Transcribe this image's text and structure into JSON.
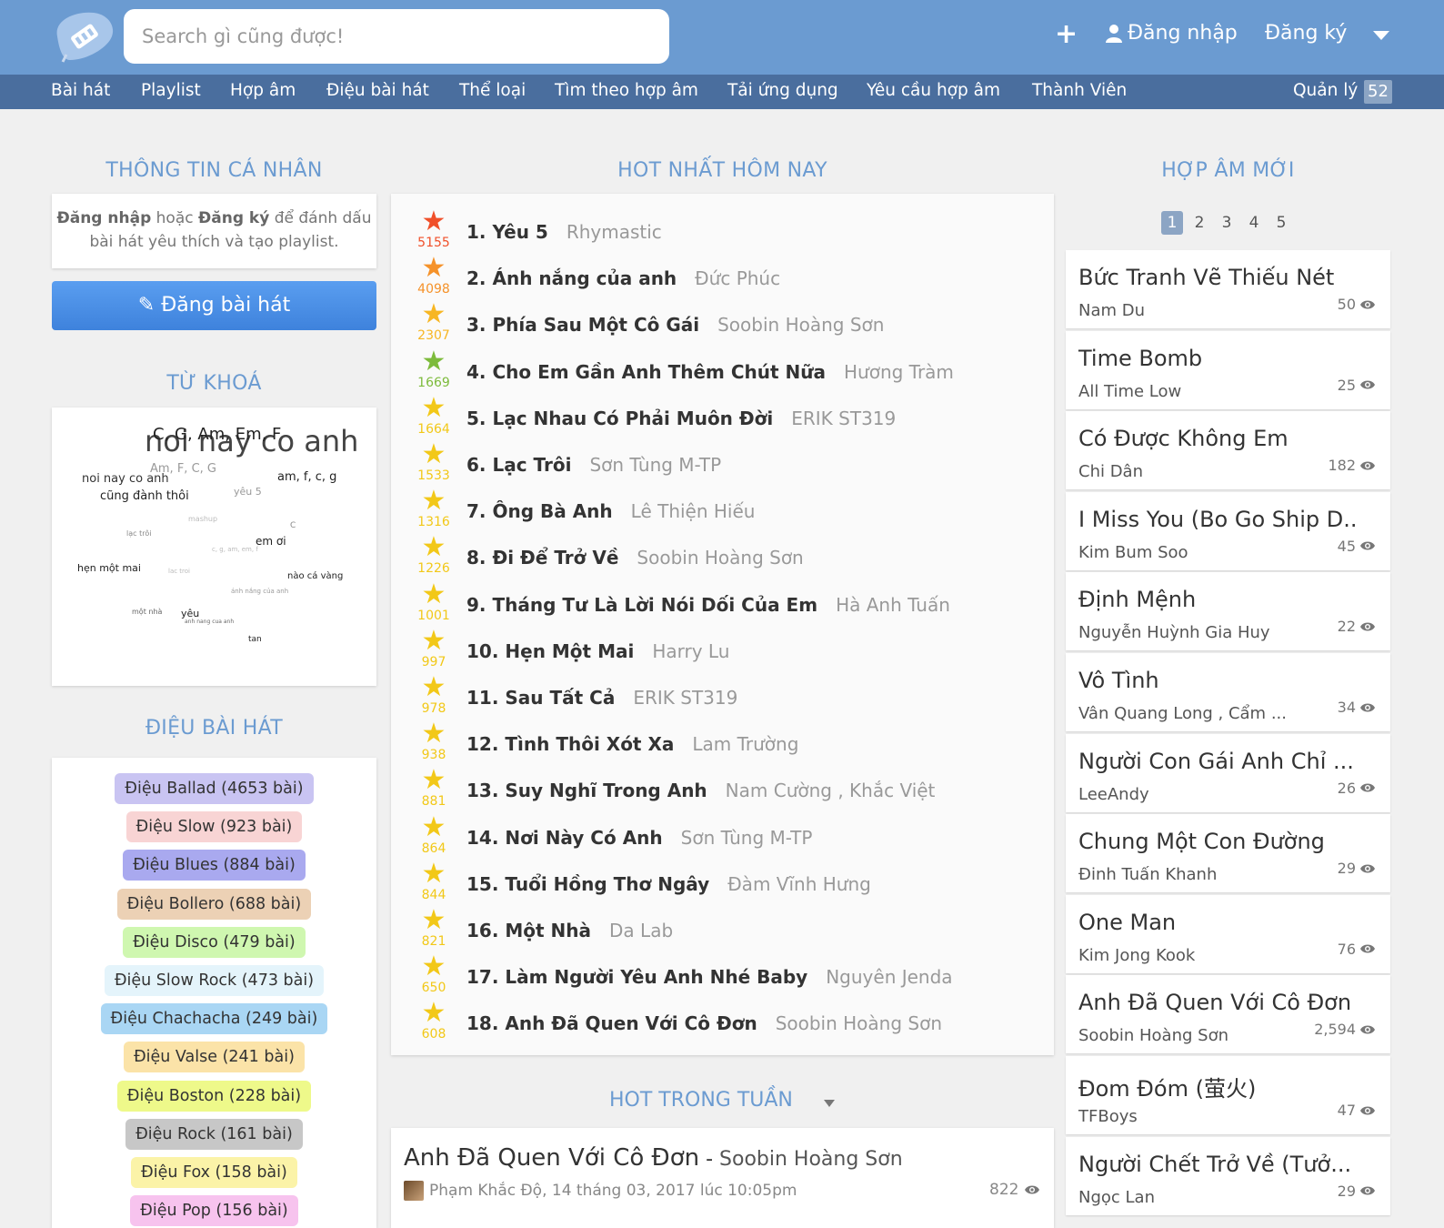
{
  "header": {
    "search_placeholder": "Search gì cũng được!",
    "plus_label": "+",
    "login_label": "Đăng nhập",
    "register_label": "Đăng ký"
  },
  "nav": {
    "items": [
      "Bài hát",
      "Playlist",
      "Hợp âm",
      "Điệu bài hát",
      "Thể loại",
      "Tìm theo hợp âm",
      "Tải ứng dụng",
      "Yêu cầu hợp âm",
      "Thành Viên"
    ],
    "manage_label": "Quản lý",
    "manage_count": "52"
  },
  "left": {
    "profile_title": "THÔNG TIN CÁ NHÂN",
    "login_note_1": "Đăng nhập",
    "login_note_2": " hoặc ",
    "login_note_3": "Đăng ký",
    "login_note_4": " để đánh dấu bài hát yêu thích và tạo playlist.",
    "post_button": "Đăng bài hát",
    "keywords_title": "TỪ KHOÁ",
    "cloud": [
      {
        "text": "C, G, Am, Em, F"
      },
      {
        "text": "noi nay co anh"
      },
      {
        "text": "Am, F, C, G"
      },
      {
        "text": "noi nay co anh"
      },
      {
        "text": "am, f, c, g"
      },
      {
        "text": "cũng đành thôi"
      },
      {
        "text": "yêu 5"
      },
      {
        "text": "mashup"
      },
      {
        "text": "C"
      },
      {
        "text": "lạc trôi"
      },
      {
        "text": "em ơi"
      },
      {
        "text": "c, g, am, em, f"
      },
      {
        "text": "hẹn một mai"
      },
      {
        "text": "lac troi"
      },
      {
        "text": "nào cá vàng"
      },
      {
        "text": "ánh nắng của anh"
      },
      {
        "text": "một nhà"
      },
      {
        "text": "yêu"
      },
      {
        "text": "anh nang cua anh"
      },
      {
        "text": "tan"
      }
    ],
    "genre_title": "ĐIỆU BÀI HÁT",
    "genres": [
      {
        "label": "Điệu Ballad (4653 bài)",
        "color": "#c9c4f2"
      },
      {
        "label": "Điệu Slow (923 bài)",
        "color": "#f8d4d4"
      },
      {
        "label": "Điệu Blues (884 bài)",
        "color": "#a9a9ef"
      },
      {
        "label": "Điệu Bollero (688 bài)",
        "color": "#ecd1b5"
      },
      {
        "label": "Điệu Disco (479 bài)",
        "color": "#cff7b0"
      },
      {
        "label": "Điệu Slow Rock (473 bài)",
        "color": "#e4f4fb"
      },
      {
        "label": "Điệu Chachacha (249 bài)",
        "color": "#a9d6f4"
      },
      {
        "label": "Điệu Valse (241 bài)",
        "color": "#fbe3a8"
      },
      {
        "label": "Điệu Boston (228 bài)",
        "color": "#eef98a"
      },
      {
        "label": "Điệu Rock (161 bài)",
        "color": "#c7c7c7"
      },
      {
        "label": "Điệu Fox (158 bài)",
        "color": "#fbf3a8"
      },
      {
        "label": "Điệu Pop (156 bài)",
        "color": "#f7c3ee"
      }
    ]
  },
  "hot": {
    "title": "HOT NHẤT HÔM NAY",
    "items": [
      {
        "rank_title": "1. Yêu 5",
        "artist": "Rhymastic",
        "count": "5155",
        "color": "#f0502a"
      },
      {
        "rank_title": "2. Ánh nắng của anh",
        "artist": "Đức Phúc",
        "count": "4098",
        "color": "#f5922a"
      },
      {
        "rank_title": "3. Phía Sau Một Cô Gái",
        "artist": "Soobin Hoàng Sơn",
        "count": "2307",
        "color": "#f7b623"
      },
      {
        "rank_title": "4. Cho Em Gần Anh Thêm Chút Nữa",
        "artist": "Hương Tràm",
        "count": "1669",
        "color": "#7dbb3c"
      },
      {
        "rank_title": "5. Lạc Nhau Có Phải Muôn Đời",
        "artist": "ERIK ST319",
        "count": "1664",
        "color": "#f2c818"
      },
      {
        "rank_title": "6. Lạc Trôi",
        "artist": "Sơn Tùng M-TP",
        "count": "1533",
        "color": "#f2c818"
      },
      {
        "rank_title": "7. Ông Bà Anh",
        "artist": "Lê Thiện Hiếu",
        "count": "1316",
        "color": "#f2c818"
      },
      {
        "rank_title": "8. Đi Để Trở Về",
        "artist": "Soobin Hoàng Sơn",
        "count": "1226",
        "color": "#f2c818"
      },
      {
        "rank_title": "9. Tháng Tư Là Lời Nói Dối Của Em",
        "artist": "Hà Anh Tuấn",
        "count": "1001",
        "color": "#f2c818"
      },
      {
        "rank_title": "10. Hẹn Một Mai",
        "artist": "Harry Lu",
        "count": "997",
        "color": "#f2c818"
      },
      {
        "rank_title": "11. Sau Tất Cả",
        "artist": "ERIK ST319",
        "count": "978",
        "color": "#f2c818"
      },
      {
        "rank_title": "12. Tình Thôi Xót Xa",
        "artist": "Lam Trường",
        "count": "938",
        "color": "#f2c818"
      },
      {
        "rank_title": "13. Suy Nghĩ Trong Anh",
        "artist": "Nam Cường , Khắc Việt",
        "count": "881",
        "color": "#f2c818"
      },
      {
        "rank_title": "14. Nơi Này Có Anh",
        "artist": "Sơn Tùng M-TP",
        "count": "864",
        "color": "#f2c818"
      },
      {
        "rank_title": "15. Tuổi Hồng Thơ Ngây",
        "artist": "Đàm Vĩnh Hưng",
        "count": "844",
        "color": "#f2c818"
      },
      {
        "rank_title": "16. Một Nhà",
        "artist": "Da Lab",
        "count": "821",
        "color": "#f2c818"
      },
      {
        "rank_title": "17. Làm Người Yêu Anh Nhé Baby",
        "artist": "Nguyên Jenda",
        "count": "650",
        "color": "#f2c818"
      },
      {
        "rank_title": "18. Anh Đã Quen Với Cô Đơn",
        "artist": "Soobin Hoàng Sơn",
        "count": "608",
        "color": "#f2c818"
      }
    ]
  },
  "week": {
    "title": "HOT TRONG TUẦN",
    "song": "Anh Đã Quen Với Cô Đơn",
    "separator": " - ",
    "artist": "Soobin Hoàng Sơn",
    "meta": "Phạm Khắc Độ, 14 tháng 03, 2017 lúc 10:05pm",
    "views": "822"
  },
  "right": {
    "title": "HỢP ÂM MỚI",
    "pages": [
      "1",
      "2",
      "3",
      "4",
      "5"
    ],
    "active_page": "1",
    "items": [
      {
        "title": "Bức Tranh Vẽ Thiếu Nét",
        "artist": "Nam Du",
        "views": "50"
      },
      {
        "title": "Time Bomb",
        "artist": "All Time Low",
        "views": "25"
      },
      {
        "title": "Có Được Không Em",
        "artist": "Chi Dân",
        "views": "182"
      },
      {
        "title": "I Miss You (Bo Go Ship D..",
        "artist": "Kim Bum Soo",
        "views": "45"
      },
      {
        "title": "Định Mệnh",
        "artist": "Nguyễn Huỳnh Gia Huy",
        "views": "22"
      },
      {
        "title": "Vô Tình",
        "artist": "Vân Quang Long , Cẩm ...",
        "views": "34"
      },
      {
        "title": "Người Con Gái Anh Chỉ ...",
        "artist": "LeeAndy",
        "views": "26"
      },
      {
        "title": "Chung Một Con Đường",
        "artist": "Đinh Tuấn Khanh",
        "views": "29"
      },
      {
        "title": "One Man",
        "artist": "Kim Jong Kook",
        "views": "76"
      },
      {
        "title": "Anh Đã Quen Với Cô Đơn",
        "artist": "Soobin Hoàng Sơn",
        "views": "2,594"
      },
      {
        "title": "Đom Đóm (萤火)",
        "artist": "TFBoys",
        "views": "47"
      },
      {
        "title": "Người Chết Trở Về (Tưở...",
        "artist": "Ngọc Lan",
        "views": "29"
      }
    ]
  }
}
